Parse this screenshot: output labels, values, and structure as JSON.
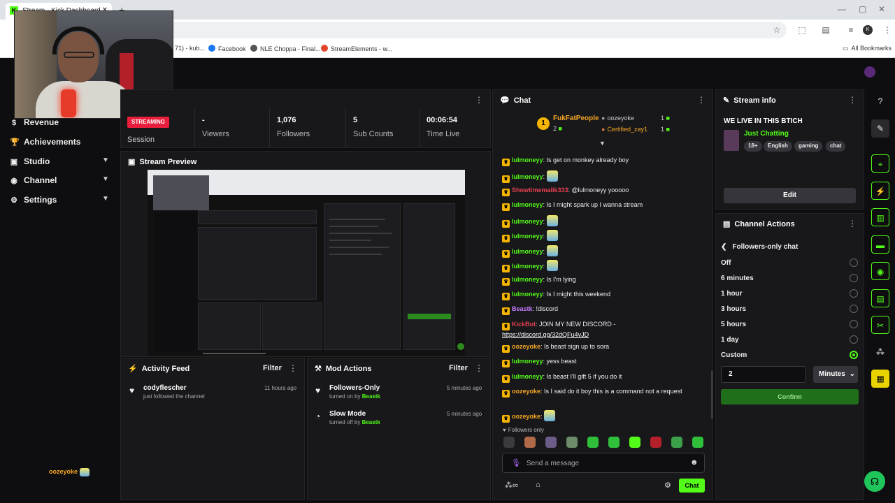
{
  "browser": {
    "tab_title": "Stream - Kick Dashboard",
    "bookmarks": [
      "71) - kub...",
      "Facebook",
      "NLE Choppa - Final...",
      "StreamElements - w..."
    ],
    "all_bookmarks": "All Bookmarks"
  },
  "nav": {
    "items": [
      {
        "label": "Revenue",
        "icon": "dollar-icon"
      },
      {
        "label": "Achievements",
        "icon": "trophy-icon"
      },
      {
        "label": "Studio",
        "icon": "video-icon"
      },
      {
        "label": "Channel",
        "icon": "channel-icon"
      },
      {
        "label": "Settings",
        "icon": "gear-icon"
      }
    ],
    "brand": "oozeyoke"
  },
  "session": {
    "status": "STREAMING",
    "label": "Session",
    "stats": [
      {
        "value": "-",
        "label": "Viewers"
      },
      {
        "value": "1,076",
        "label": "Followers"
      },
      {
        "value": "5",
        "label": "Sub Counts"
      },
      {
        "value": "00:06:54",
        "label": "Time Live"
      }
    ]
  },
  "preview": {
    "title": "Stream Preview"
  },
  "activity": {
    "title": "Activity Feed",
    "filter": "Filter",
    "items": [
      {
        "name": "codyflescher",
        "sub": "just followed the channel",
        "time": "11 hours ago"
      }
    ]
  },
  "mod_actions": {
    "title": "Mod Actions",
    "filter": "Filter",
    "items": [
      {
        "title": "Followers-Only",
        "action": "turned on by",
        "by": "Beastk",
        "time": "5 minutes ago"
      },
      {
        "title": "Slow Mode",
        "action": "turned off by",
        "by": "Beastk",
        "time": "5 minutes ago"
      }
    ]
  },
  "chat": {
    "title": "Chat",
    "pinned": {
      "top": {
        "rank": "1",
        "name": "FukFatPeople",
        "count": "2"
      },
      "second": {
        "name": "oozeyoke",
        "count": "1"
      },
      "third": {
        "name": "Certified_zay1",
        "count": "1"
      }
    },
    "messages": [
      {
        "user": "lulmoneyy",
        "color": "#53fc18",
        "text": ": Is get on monkey already boy"
      },
      {
        "user": "lulmoneyy",
        "color": "#53fc18",
        "text": ":",
        "emote": true
      },
      {
        "user": "Showtimemalik333",
        "color": "#e8404f",
        "text": ": @lulmoneyy yooooo"
      },
      {
        "user": "lulmoneyy",
        "color": "#53fc18",
        "text": ": Is I might spark up I wanna stream"
      },
      {
        "user": "lulmoneyy",
        "color": "#53fc18",
        "text": ":",
        "emote": true
      },
      {
        "user": "lulmoneyy",
        "color": "#53fc18",
        "text": ":",
        "emote": true
      },
      {
        "user": "lulmoneyy",
        "color": "#53fc18",
        "text": ":",
        "emote": true
      },
      {
        "user": "lulmoneyy",
        "color": "#53fc18",
        "text": ":",
        "emote": true
      },
      {
        "user": "lulmoneyy",
        "color": "#53fc18",
        "text": ": Is I'm lying"
      },
      {
        "user": "lulmoneyy",
        "color": "#53fc18",
        "text": ": Is I might this weekend"
      },
      {
        "user": "Beastk",
        "color": "#c77dff",
        "text": ": !discord"
      },
      {
        "user": "KickBot",
        "color": "#e8404f",
        "text": ": JOIN MY NEW DISCORD -",
        "link": "https://discord.gg/32dQFu4vJD"
      },
      {
        "user": "oozeyoke",
        "color": "#f5a623",
        "text": ": Is beast sign up to sora"
      },
      {
        "user": "lulmoneyy",
        "color": "#53fc18",
        "text": ": yess beast"
      },
      {
        "user": "lulmoneyy",
        "color": "#53fc18",
        "text": ": Is beast I'll gift 5 if you do it"
      },
      {
        "user": "oozeyoke",
        "color": "#f5a623",
        "text": ": Is I said do it boy this is a command not a request"
      },
      {
        "user": "oozeyoke",
        "color": "#f5a623",
        "text": ":",
        "emote": true
      }
    ],
    "mode": "Followers only",
    "placeholder": "Send a message",
    "chat_button": "Chat"
  },
  "stream_info": {
    "title": "Stream info",
    "stream_title": "WE LIVE IN THIS BTICH",
    "category": "Just Chatting",
    "tags": [
      "18+",
      "English",
      "gaming",
      "chat"
    ],
    "edit": "Edit"
  },
  "channel_actions": {
    "title": "Channel Actions",
    "back_label": "Followers-only chat",
    "options": [
      {
        "label": "Off",
        "selected": false
      },
      {
        "label": "6 minutes",
        "selected": false
      },
      {
        "label": "1 hour",
        "selected": false
      },
      {
        "label": "3 hours",
        "selected": false
      },
      {
        "label": "5 hours",
        "selected": false
      },
      {
        "label": "1 day",
        "selected": false
      },
      {
        "label": "Custom",
        "selected": true
      }
    ],
    "custom_value": "2",
    "unit": "Minutes",
    "confirm": "Confirm"
  },
  "colors": {
    "accent": "#53fc18",
    "live": "#e91e3c",
    "panel": "#18181b",
    "bg": "#0e0e10"
  }
}
